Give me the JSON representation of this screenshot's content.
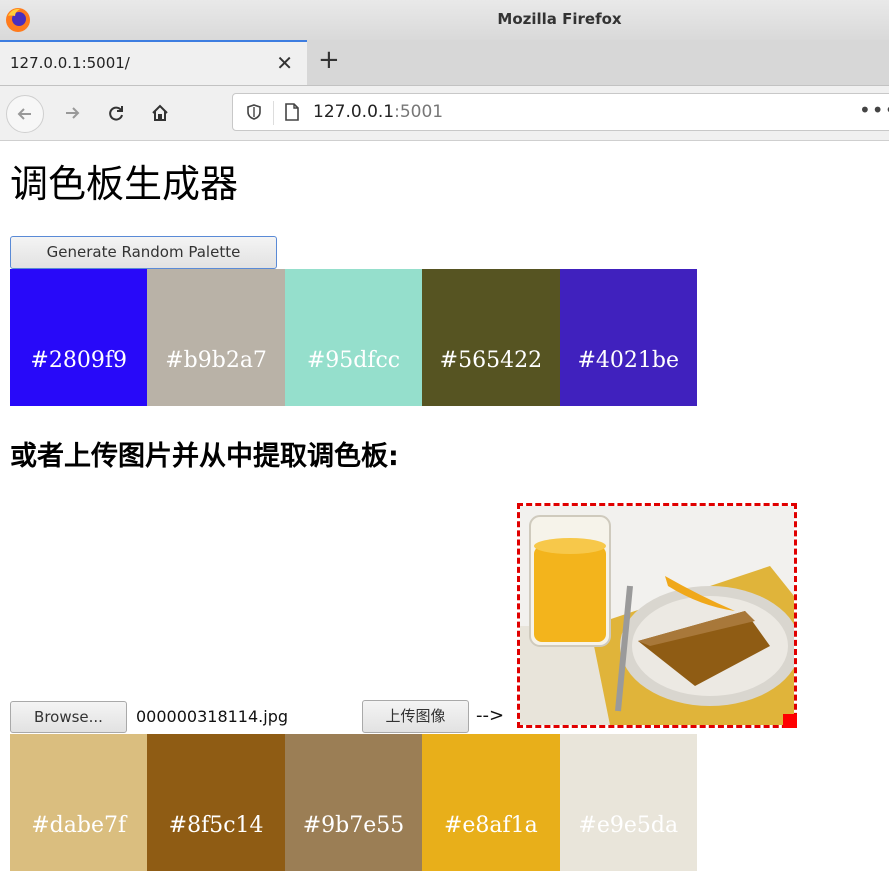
{
  "browser": {
    "window_title": "Mozilla Firefox",
    "tab_title": "127.0.0.1:5001/",
    "url_host": "127.0.0.1",
    "url_port": ":5001",
    "new_tab_symbol": "+",
    "tab_close_symbol": "✕",
    "more_symbol": "•••"
  },
  "page": {
    "title": "调色板生成器",
    "generate_button": "Generate Random Palette",
    "palette1": [
      {
        "hex": "#2809f9",
        "label": "#2809f9"
      },
      {
        "hex": "#b9b2a7",
        "label": "#b9b2a7"
      },
      {
        "hex": "#95dfcc",
        "label": "#95dfcc"
      },
      {
        "hex": "#565422",
        "label": "#565422"
      },
      {
        "hex": "#4021be",
        "label": "#4021be"
      }
    ],
    "upload_heading": "或者上传图片并从中提取调色板:",
    "browse_button": "Browse...",
    "file_name": "000000318114.jpg",
    "upload_button": "上传图像",
    "arrow_text": "-->",
    "palette2": [
      {
        "hex": "#dabe7f",
        "label": "#dabe7f"
      },
      {
        "hex": "#8f5c14",
        "label": "#8f5c14"
      },
      {
        "hex": "#9b7e55",
        "label": "#9b7e55"
      },
      {
        "hex": "#e8af1a",
        "label": "#e8af1a"
      },
      {
        "hex": "#e9e5da",
        "label": "#e9e5da"
      }
    ]
  },
  "colors": {
    "selection_border": "#e00000",
    "tab_accent": "#3d7de0"
  }
}
